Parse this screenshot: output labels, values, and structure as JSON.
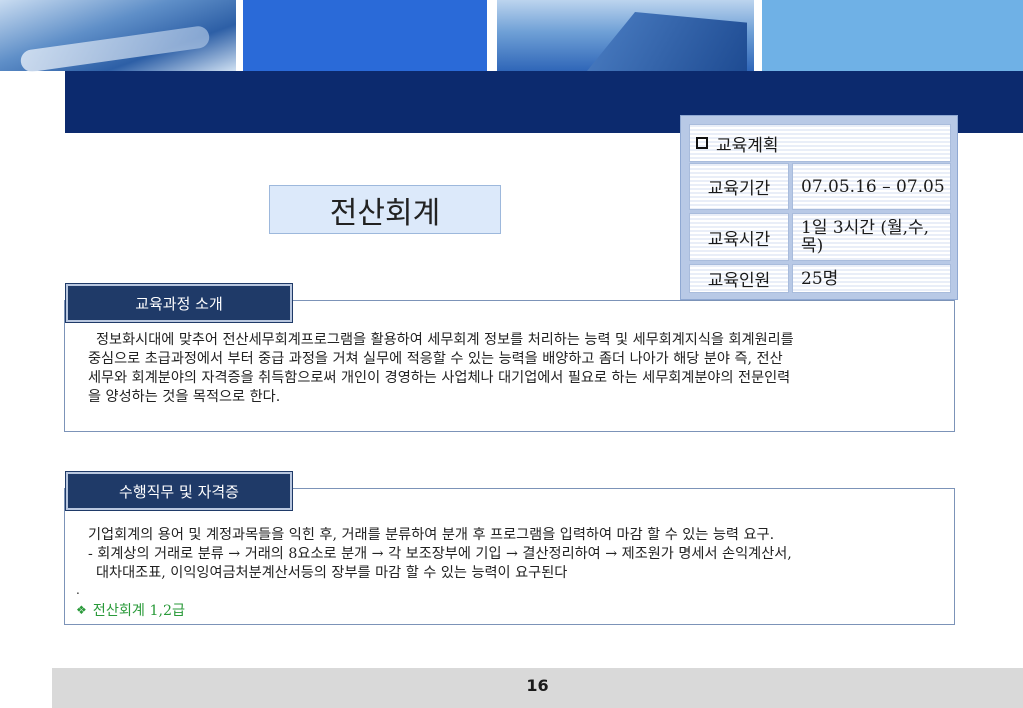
{
  "colors": {
    "navy_bar": "#0c2a6e",
    "tab_bg": "#1f3a68",
    "title_bg": "#dce9fa",
    "cert_green": "#2a9a3a",
    "footer_bg": "#d9d9d9"
  },
  "title": "전산회계",
  "plan": {
    "header": "교육계획",
    "rows": [
      {
        "label": "교육기간",
        "value": "07.05.16 – 07.05"
      },
      {
        "label": "교육시간",
        "value": "1일 3시간 (월,수,목)"
      },
      {
        "label": "교육인원",
        "value": "25명"
      }
    ]
  },
  "section1": {
    "tab": "교육과정 소개",
    "lines": [
      "정보화시대에 맞추어 전산세무회계프로그램을 활용하여 세무회계 정보를 처리하는 능력 및 세무회계지식을 회계원리를",
      "중심으로 초급과정에서 부터 중급 과정을 거쳐 실무에 적응할 수 있는 능력을 배양하고 좀더 나아가 해당 분야 즉, 전산",
      "세무와 회계분야의 자격증을 취득함으로써 개인이 경영하는 사업체나 대기업에서 필요로 하는 세무회계분야의 전문인력",
      "을 양성하는 것을 목적으로 한다."
    ]
  },
  "section2": {
    "tab": "수행직무 및 자격증",
    "lines": [
      "기업회계의 용어 및 계정과목들을 익힌 후, 거래를 분류하여 분개 후 프로그램을 입력하여 마감 할 수 있는 능력 요구.",
      "- 회계상의 거래로 분류 → 거래의 8요소로 분개 → 각 보조장부에 기입 → 결산정리하여 → 제조원가 명세서 손익계산서,",
      "  대차대조표, 이익잉여금처분계산서등의 장부를 마감 할 수 있는 능력이 요구된다"
    ],
    "dot": ".",
    "cert_icon": "diamond-bullet-icon",
    "cert": "전산회계 1,2급"
  },
  "page_number": "16"
}
